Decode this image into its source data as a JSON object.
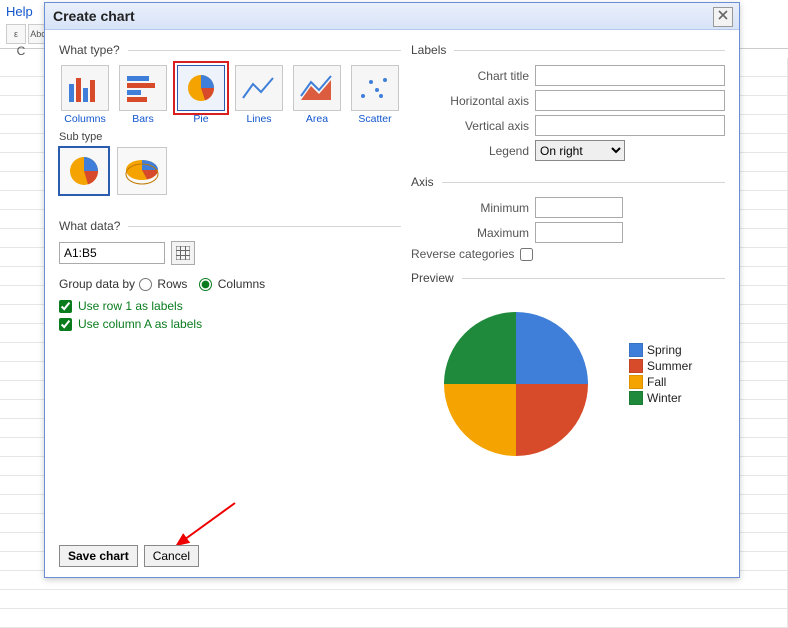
{
  "background": {
    "help_menu": "Help",
    "toolbar_icon": "Abc",
    "column_letter": "C"
  },
  "dialog": {
    "title": "Create chart",
    "sections": {
      "type": "What type?",
      "subtype": "Sub type",
      "data": "What data?",
      "labels": "Labels",
      "axis": "Axis",
      "preview": "Preview"
    },
    "types": [
      {
        "id": "columns",
        "label": "Columns"
      },
      {
        "id": "bars",
        "label": "Bars"
      },
      {
        "id": "pie",
        "label": "Pie"
      },
      {
        "id": "lines",
        "label": "Lines"
      },
      {
        "id": "area",
        "label": "Area"
      },
      {
        "id": "scatter",
        "label": "Scatter"
      }
    ],
    "selected_type": "pie",
    "selected_subtype": 0,
    "data_range": "A1:B5",
    "group_data_label": "Group data by",
    "group_rows": "Rows",
    "group_cols": "Columns",
    "group_selected": "Columns",
    "use_row1": "Use row 1 as labels",
    "use_colA": "Use column A as labels",
    "use_row1_checked": true,
    "use_colA_checked": true,
    "labels_form": {
      "chart_title": "Chart title",
      "hor_axis": "Horizontal axis",
      "ver_axis": "Vertical axis",
      "legend": "Legend",
      "legend_value": "On right"
    },
    "axis_form": {
      "minimum": "Minimum",
      "maximum": "Maximum",
      "reverse": "Reverse categories"
    },
    "buttons": {
      "save": "Save chart",
      "cancel": "Cancel"
    }
  },
  "chart_data": {
    "type": "pie",
    "title": "",
    "series": [
      {
        "name": "Spring",
        "value": 25,
        "color": "#3f7fd9"
      },
      {
        "name": "Summer",
        "value": 25,
        "color": "#d84b2a"
      },
      {
        "name": "Fall",
        "value": 25,
        "color": "#f4a300"
      },
      {
        "name": "Winter",
        "value": 25,
        "color": "#1f8a3b"
      }
    ],
    "legend_position": "right"
  }
}
